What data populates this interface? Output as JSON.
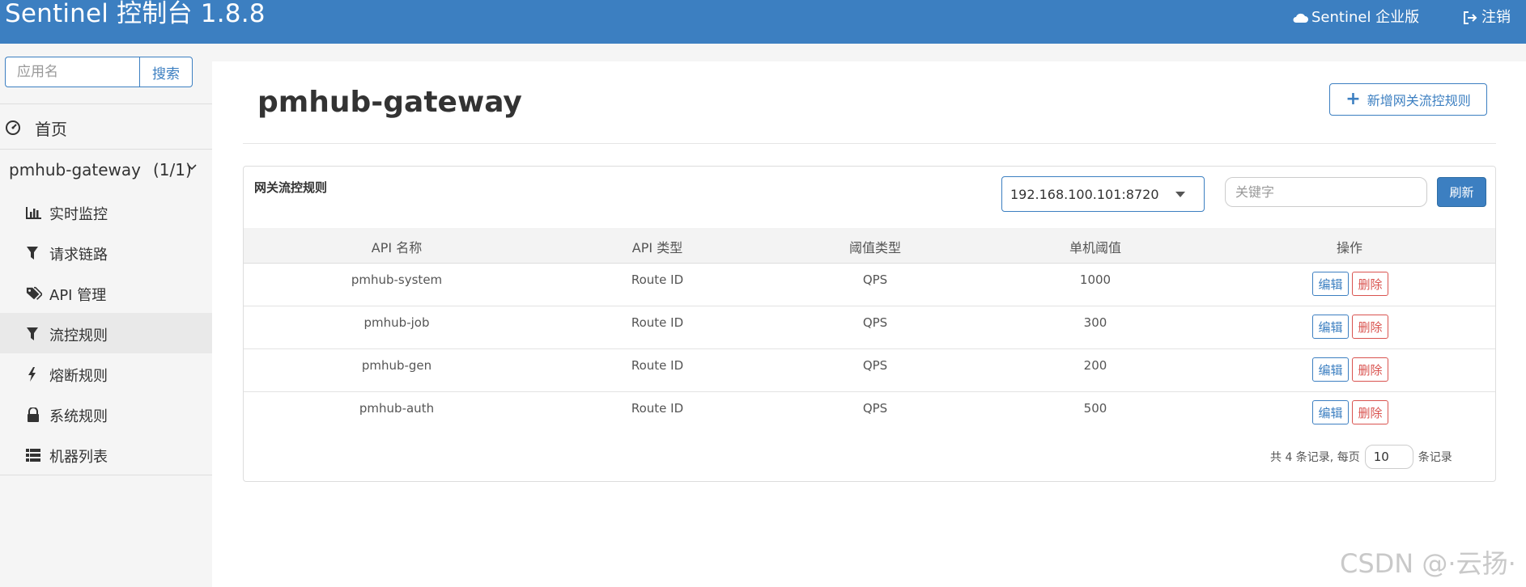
{
  "header": {
    "title": "Sentinel 控制台 1.8.8",
    "enterprise_label": "Sentinel 企业版",
    "logout_label": "注销"
  },
  "sidebar": {
    "search_placeholder": "应用名",
    "search_button": "搜索",
    "home_label": "首页",
    "app_name": "pmhub-gateway",
    "app_count": "(1/1)",
    "items": [
      {
        "label": "实时监控",
        "icon": "bar-chart-icon"
      },
      {
        "label": "请求链路",
        "icon": "filter-icon"
      },
      {
        "label": "API 管理",
        "icon": "tags-icon"
      },
      {
        "label": "流控规则",
        "icon": "filter-icon",
        "active": true
      },
      {
        "label": "熔断规则",
        "icon": "lightning-icon"
      },
      {
        "label": "系统规则",
        "icon": "lock-icon"
      },
      {
        "label": "机器列表",
        "icon": "list-icon"
      }
    ]
  },
  "main": {
    "title": "pmhub-gateway",
    "add_button": "新增网关流控规则",
    "panel_title": "网关流控规则",
    "machine_select": "192.168.100.101:8720",
    "keyword_placeholder": "关键字",
    "refresh_button": "刷新",
    "columns": [
      "API 名称",
      "API 类型",
      "阈值类型",
      "单机阈值",
      "操作"
    ],
    "rows": [
      {
        "api_name": "pmhub-system",
        "api_type": "Route ID",
        "threshold_type": "QPS",
        "threshold": "1000"
      },
      {
        "api_name": "pmhub-job",
        "api_type": "Route ID",
        "threshold_type": "QPS",
        "threshold": "300"
      },
      {
        "api_name": "pmhub-gen",
        "api_type": "Route ID",
        "threshold_type": "QPS",
        "threshold": "200"
      },
      {
        "api_name": "pmhub-auth",
        "api_type": "Route ID",
        "threshold_type": "QPS",
        "threshold": "500"
      }
    ],
    "edit_label": "编辑",
    "delete_label": "删除",
    "pager": {
      "total_text": "共 4 条记录, 每页",
      "page_size": "10",
      "suffix": "条记录"
    }
  },
  "watermark": "CSDN @·云扬·",
  "colors": {
    "primary": "#3c7fc1",
    "danger": "#d9534f",
    "sidebar_bg": "#f5f5f5"
  }
}
